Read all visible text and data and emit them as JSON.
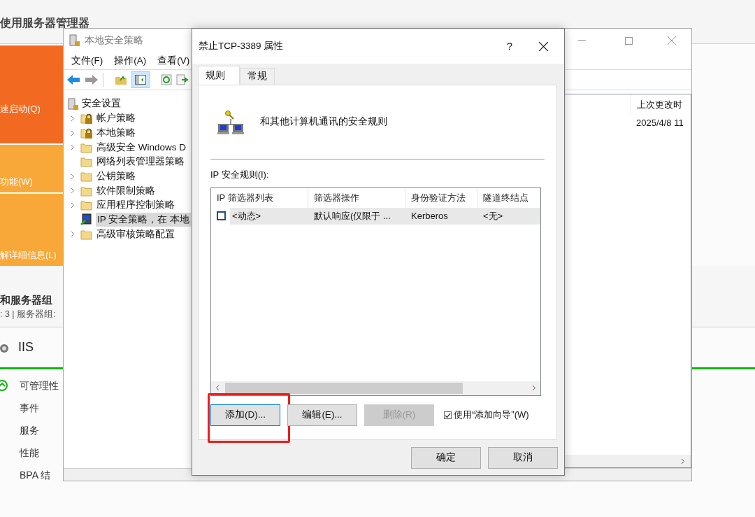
{
  "server_manager": {
    "title": "使用服务器管理器",
    "tiles": [
      {
        "label": "速启动(Q)",
        "color": "#f26a22"
      },
      {
        "label": "功能(W)",
        "color": "#f8a838"
      },
      {
        "label": "解详细信息(L)",
        "color": "#f8a838"
      }
    ],
    "groups_title": "和服务器组",
    "groups_subtitle": ": 3 | 服务器组:",
    "role": {
      "name": "IIS",
      "status_item": "可管理性",
      "items": [
        "事件",
        "服务",
        "性能",
        "BPA 结"
      ]
    }
  },
  "policy_window": {
    "title": "本地安全策略",
    "menu": [
      "文件(F)",
      "操作(A)",
      "查看(V)"
    ],
    "tree": {
      "label": "安全设置",
      "children": [
        {
          "label": "帐户策略",
          "expandable": true,
          "locked": true,
          "selected": false
        },
        {
          "label": "本地策略",
          "expandable": true,
          "locked": true,
          "selected": false
        },
        {
          "label": "高级安全 Windows D",
          "expandable": true,
          "locked": false,
          "selected": false
        },
        {
          "label": "网络列表管理器策略",
          "expandable": false,
          "locked": false,
          "selected": false
        },
        {
          "label": "公钥策略",
          "expandable": true,
          "locked": false,
          "selected": false
        },
        {
          "label": "软件限制策略",
          "expandable": true,
          "locked": false,
          "selected": false
        },
        {
          "label": "应用程序控制策略",
          "expandable": true,
          "locked": false,
          "selected": false
        },
        {
          "label": "IP 安全策略，在 本地",
          "expandable": false,
          "locked": false,
          "selected": true,
          "kind": "computer"
        },
        {
          "label": "高级审核策略配置",
          "expandable": true,
          "locked": false,
          "selected": false
        }
      ]
    },
    "detail_column": "上次更改时",
    "detail_value": "2025/4/8 11"
  },
  "dialog": {
    "title": "禁止TCP-3389 属性",
    "help": "?",
    "tabs": [
      {
        "label": "规则",
        "selected": true
      },
      {
        "label": "常规",
        "selected": false
      }
    ],
    "header_text": "和其他计算机通讯的安全规则",
    "rules_label": "IP 安全规则(I):",
    "columns": [
      "IP 筛选器列表",
      "筛选器操作",
      "身份验证方法",
      "隧道终结点"
    ],
    "rows": [
      {
        "checked": false,
        "cells": [
          "<动态>",
          "默认响应(仅限于 ...",
          "Kerberos",
          "<无>"
        ]
      }
    ],
    "buttons": [
      {
        "label": "添加(D)...",
        "disabled": false,
        "focused": true,
        "annotated": true
      },
      {
        "label": "编辑(E)...",
        "disabled": false,
        "focused": false,
        "annotated": false
      },
      {
        "label": "删除(R)",
        "disabled": true,
        "focused": false,
        "annotated": false
      }
    ],
    "wizard": {
      "label": "使用“添加向导”(W)",
      "checked": true
    },
    "footer_buttons": [
      "确定",
      "取消"
    ]
  }
}
